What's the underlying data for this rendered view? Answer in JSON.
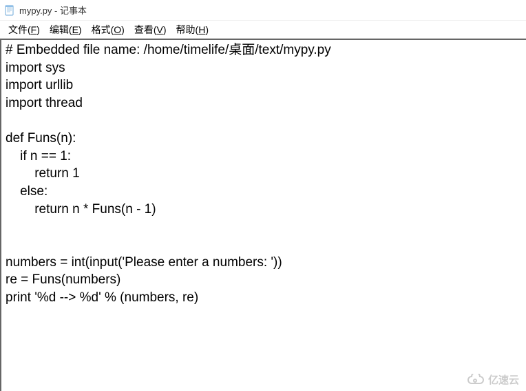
{
  "window": {
    "title": "mypy.py - 记事本"
  },
  "menu": {
    "file": "文件(F)",
    "edit": "编辑(E)",
    "format": "格式(O)",
    "view": "查看(V)",
    "help": "帮助(H)"
  },
  "editor": {
    "lines": [
      "# Embedded file name: /home/timelife/桌面/text/mypy.py",
      "import sys",
      "import urllib",
      "import thread",
      "",
      "def Funs(n):",
      "    if n == 1:",
      "        return 1",
      "    else:",
      "        return n * Funs(n - 1)",
      "",
      "",
      "numbers = int(input('Please enter a numbers: '))",
      "re = Funs(numbers)",
      "print '%d --> %d' % (numbers, re)"
    ]
  },
  "watermark": {
    "text": "亿速云"
  }
}
